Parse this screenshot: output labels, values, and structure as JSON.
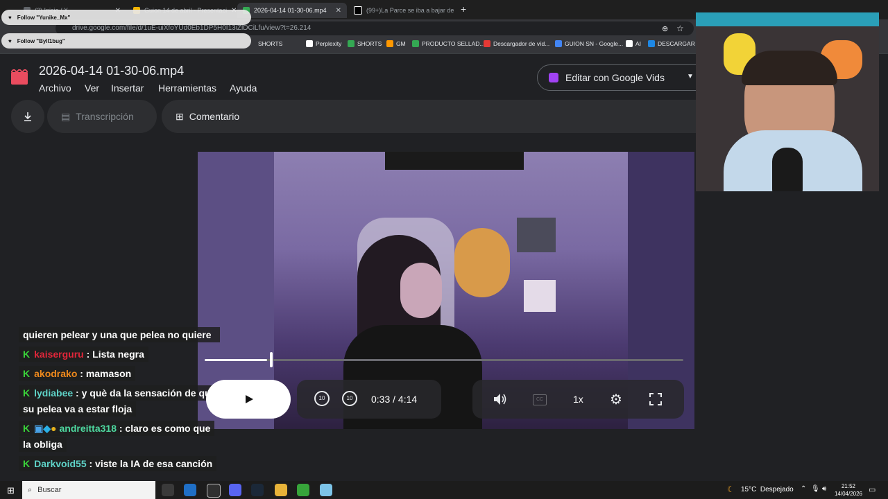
{
  "browser": {
    "tabs": [
      {
        "label": "(2) Inicio / X",
        "color": "#5f6368"
      },
      {
        "label": "Guion 14 de abril - Presentaci",
        "color": "#f4b400"
      },
      {
        "label": "2026-04-14 01-30-06.mp4",
        "color": "#34a853"
      },
      {
        "label": "(99+)La Parce se iba a bajar de",
        "color": "#000000"
      }
    ],
    "new_tab": "+",
    "url": "drive.google.com/file/d/1uE-uiXfoYUd0Eb1DP5H0I13iZlDCiLfu/view?t=26.214",
    "bookmarks": [
      "SHORTS",
      "Perplexity",
      "SHORTS",
      "GM",
      "PRODUCTO SELLAD...",
      "Descargador de víd...",
      "GUION SN - Google...",
      "AI",
      "DESCARGAR TV"
    ],
    "follow_alerts": [
      "Follow \"Yunike_Mx\"",
      "Follow \"Byll1bug\""
    ]
  },
  "drive": {
    "title": "2026-04-14 01-30-06.mp4",
    "menus": [
      "Archivo",
      "Ver",
      "Insertar",
      "Herramientas",
      "Ayuda"
    ],
    "edit_button": "Editar con Google Vids",
    "toolbar": {
      "download_icon": "download-icon",
      "transcription": "Transcripción",
      "comment": "Comentario"
    }
  },
  "player": {
    "current_time": "0:33",
    "separator": "/",
    "duration": "4:14",
    "progress_fraction": 0.13,
    "speed": "1x",
    "skip_back": "10",
    "skip_forward": "10"
  },
  "chat": [
    {
      "user": "",
      "text": "quieren pelear y una que pelea no quiere",
      "color": "#ffffff"
    },
    {
      "user": "kaiserguru",
      "text": ": Lista negra",
      "color": "#e0263a"
    },
    {
      "user": "akodrako",
      "text": ": mamason",
      "color": "#f08a1c"
    },
    {
      "user": "lydiabee",
      "text": ": y què da la sensación de que",
      "color": "#5fd3c8"
    },
    {
      "user": "",
      "text": "su pelea va a estar floja",
      "color": "#ffffff"
    },
    {
      "user": "andreitta318",
      "text": ": claro es como que",
      "color": "#4ed9a0"
    },
    {
      "user": "",
      "text": "la obliga",
      "color": "#ffffff"
    },
    {
      "user": "Darkvoid55",
      "text": ": viste la IA de esa canción",
      "color": "#5fd3c8"
    }
  ],
  "taskbar": {
    "search_placeholder": "Buscar",
    "weather": "15°C  Despejado",
    "time": "21:52",
    "date": "14/04/2026"
  }
}
